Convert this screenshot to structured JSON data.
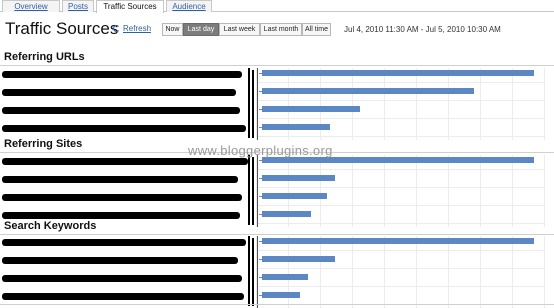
{
  "tabs": [
    {
      "label": "Overview",
      "active": false
    },
    {
      "label": "Posts",
      "active": false
    },
    {
      "label": "Traffic Sources",
      "active": true
    },
    {
      "label": "Audience",
      "active": false
    }
  ],
  "page_title": "Traffic Sources",
  "refresh_label": "Refresh",
  "range_buttons": [
    {
      "label": "Now",
      "selected": false
    },
    {
      "label": "Last day",
      "selected": true
    },
    {
      "label": "Last week",
      "selected": false
    },
    {
      "label": "Last month",
      "selected": false
    },
    {
      "label": "All time",
      "selected": false
    }
  ],
  "date_range": "Jul 4, 2010 11:30 AM - Jul 5, 2010 10:30 AM",
  "watermark": "www.bloggerplugins.org",
  "colors": {
    "bar": "#5b88c4",
    "selected_button": "#7d7d7d",
    "link": "#2f5fa6"
  },
  "sections": [
    {
      "title": "Referring URLs",
      "bars": [
        1.0,
        0.78,
        0.36,
        0.25
      ]
    },
    {
      "title": "Referring Sites",
      "bars": [
        1.0,
        0.27,
        0.24,
        0.18
      ]
    },
    {
      "title": "Search Keywords",
      "bars": [
        1.0,
        0.27,
        0.17,
        0.14
      ]
    }
  ]
}
